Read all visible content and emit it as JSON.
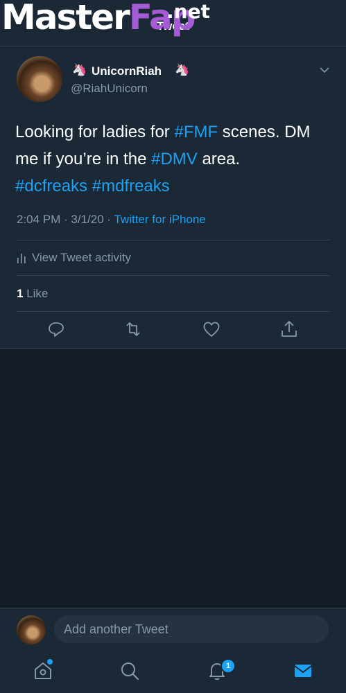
{
  "watermark": {
    "text_a": "Master",
    "text_b": "Fap",
    "suffix": ".net"
  },
  "header": {
    "title": "Tweet"
  },
  "tweet": {
    "display_name": "UnicornRiah",
    "handle": "@RiahUnicorn",
    "text_parts": {
      "p1": "Looking for ladies for ",
      "h1": "#FMF",
      "p2": " scenes. DM me if you’re in the ",
      "h2": "#DMV",
      "p3": " area.",
      "h3": "#dcfreaks",
      "h4": "#mdfreaks"
    },
    "time": "2:04 PM · 3/1/20 · ",
    "source": "Twitter for iPhone",
    "activity_label": "View Tweet activity",
    "like_count": "1",
    "like_label": "Like"
  },
  "reply": {
    "placeholder": "Add another Tweet"
  },
  "tabs": {
    "notifications_badge": "1"
  },
  "colors": {
    "accent": "#1da1f2",
    "background": "#141d26",
    "panel": "#1b2836",
    "muted": "#8899a6"
  },
  "icons": [
    "unicorn-icon",
    "chevron-down-icon",
    "activity-icon",
    "reply-icon",
    "retweet-icon",
    "like-icon",
    "share-icon",
    "home-icon",
    "search-icon",
    "bell-icon",
    "mail-icon"
  ]
}
